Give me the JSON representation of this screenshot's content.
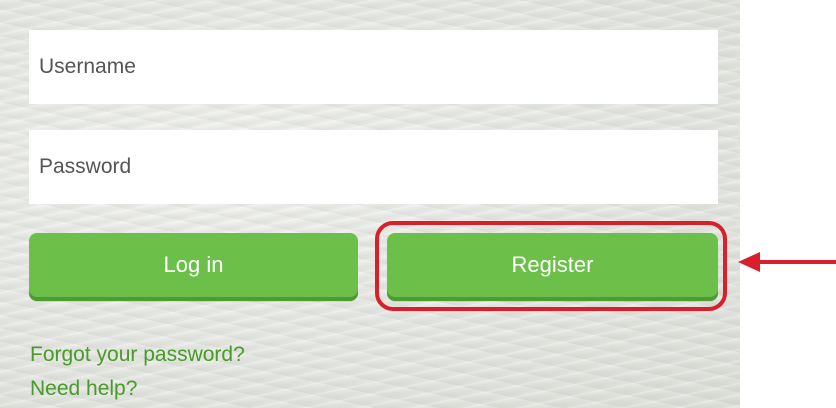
{
  "login_form": {
    "username_placeholder": "Username",
    "password_placeholder": "Password",
    "login_label": "Log in",
    "register_label": "Register",
    "forgot_password_label": "Forgot your password?",
    "need_help_label": "Need help?"
  },
  "annotation": {
    "highlight_target": "register-button",
    "highlight_color": "#d81f2a",
    "arrow_icon": "arrow-left-icon"
  },
  "colors": {
    "button_green": "#6cc04a",
    "link_green": "#4a9a2a"
  }
}
